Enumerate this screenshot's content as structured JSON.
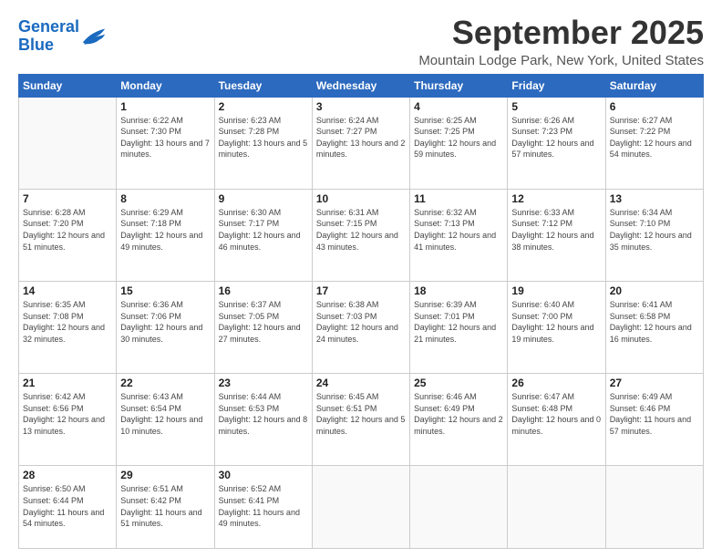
{
  "logo": {
    "line1": "General",
    "line2": "Blue"
  },
  "title": "September 2025",
  "location": "Mountain Lodge Park, New York, United States",
  "days_header": [
    "Sunday",
    "Monday",
    "Tuesday",
    "Wednesday",
    "Thursday",
    "Friday",
    "Saturday"
  ],
  "weeks": [
    [
      {
        "num": "",
        "sunrise": "",
        "sunset": "",
        "daylight": ""
      },
      {
        "num": "1",
        "sunrise": "Sunrise: 6:22 AM",
        "sunset": "Sunset: 7:30 PM",
        "daylight": "Daylight: 13 hours and 7 minutes."
      },
      {
        "num": "2",
        "sunrise": "Sunrise: 6:23 AM",
        "sunset": "Sunset: 7:28 PM",
        "daylight": "Daylight: 13 hours and 5 minutes."
      },
      {
        "num": "3",
        "sunrise": "Sunrise: 6:24 AM",
        "sunset": "Sunset: 7:27 PM",
        "daylight": "Daylight: 13 hours and 2 minutes."
      },
      {
        "num": "4",
        "sunrise": "Sunrise: 6:25 AM",
        "sunset": "Sunset: 7:25 PM",
        "daylight": "Daylight: 12 hours and 59 minutes."
      },
      {
        "num": "5",
        "sunrise": "Sunrise: 6:26 AM",
        "sunset": "Sunset: 7:23 PM",
        "daylight": "Daylight: 12 hours and 57 minutes."
      },
      {
        "num": "6",
        "sunrise": "Sunrise: 6:27 AM",
        "sunset": "Sunset: 7:22 PM",
        "daylight": "Daylight: 12 hours and 54 minutes."
      }
    ],
    [
      {
        "num": "7",
        "sunrise": "Sunrise: 6:28 AM",
        "sunset": "Sunset: 7:20 PM",
        "daylight": "Daylight: 12 hours and 51 minutes."
      },
      {
        "num": "8",
        "sunrise": "Sunrise: 6:29 AM",
        "sunset": "Sunset: 7:18 PM",
        "daylight": "Daylight: 12 hours and 49 minutes."
      },
      {
        "num": "9",
        "sunrise": "Sunrise: 6:30 AM",
        "sunset": "Sunset: 7:17 PM",
        "daylight": "Daylight: 12 hours and 46 minutes."
      },
      {
        "num": "10",
        "sunrise": "Sunrise: 6:31 AM",
        "sunset": "Sunset: 7:15 PM",
        "daylight": "Daylight: 12 hours and 43 minutes."
      },
      {
        "num": "11",
        "sunrise": "Sunrise: 6:32 AM",
        "sunset": "Sunset: 7:13 PM",
        "daylight": "Daylight: 12 hours and 41 minutes."
      },
      {
        "num": "12",
        "sunrise": "Sunrise: 6:33 AM",
        "sunset": "Sunset: 7:12 PM",
        "daylight": "Daylight: 12 hours and 38 minutes."
      },
      {
        "num": "13",
        "sunrise": "Sunrise: 6:34 AM",
        "sunset": "Sunset: 7:10 PM",
        "daylight": "Daylight: 12 hours and 35 minutes."
      }
    ],
    [
      {
        "num": "14",
        "sunrise": "Sunrise: 6:35 AM",
        "sunset": "Sunset: 7:08 PM",
        "daylight": "Daylight: 12 hours and 32 minutes."
      },
      {
        "num": "15",
        "sunrise": "Sunrise: 6:36 AM",
        "sunset": "Sunset: 7:06 PM",
        "daylight": "Daylight: 12 hours and 30 minutes."
      },
      {
        "num": "16",
        "sunrise": "Sunrise: 6:37 AM",
        "sunset": "Sunset: 7:05 PM",
        "daylight": "Daylight: 12 hours and 27 minutes."
      },
      {
        "num": "17",
        "sunrise": "Sunrise: 6:38 AM",
        "sunset": "Sunset: 7:03 PM",
        "daylight": "Daylight: 12 hours and 24 minutes."
      },
      {
        "num": "18",
        "sunrise": "Sunrise: 6:39 AM",
        "sunset": "Sunset: 7:01 PM",
        "daylight": "Daylight: 12 hours and 21 minutes."
      },
      {
        "num": "19",
        "sunrise": "Sunrise: 6:40 AM",
        "sunset": "Sunset: 7:00 PM",
        "daylight": "Daylight: 12 hours and 19 minutes."
      },
      {
        "num": "20",
        "sunrise": "Sunrise: 6:41 AM",
        "sunset": "Sunset: 6:58 PM",
        "daylight": "Daylight: 12 hours and 16 minutes."
      }
    ],
    [
      {
        "num": "21",
        "sunrise": "Sunrise: 6:42 AM",
        "sunset": "Sunset: 6:56 PM",
        "daylight": "Daylight: 12 hours and 13 minutes."
      },
      {
        "num": "22",
        "sunrise": "Sunrise: 6:43 AM",
        "sunset": "Sunset: 6:54 PM",
        "daylight": "Daylight: 12 hours and 10 minutes."
      },
      {
        "num": "23",
        "sunrise": "Sunrise: 6:44 AM",
        "sunset": "Sunset: 6:53 PM",
        "daylight": "Daylight: 12 hours and 8 minutes."
      },
      {
        "num": "24",
        "sunrise": "Sunrise: 6:45 AM",
        "sunset": "Sunset: 6:51 PM",
        "daylight": "Daylight: 12 hours and 5 minutes."
      },
      {
        "num": "25",
        "sunrise": "Sunrise: 6:46 AM",
        "sunset": "Sunset: 6:49 PM",
        "daylight": "Daylight: 12 hours and 2 minutes."
      },
      {
        "num": "26",
        "sunrise": "Sunrise: 6:47 AM",
        "sunset": "Sunset: 6:48 PM",
        "daylight": "Daylight: 12 hours and 0 minutes."
      },
      {
        "num": "27",
        "sunrise": "Sunrise: 6:49 AM",
        "sunset": "Sunset: 6:46 PM",
        "daylight": "Daylight: 11 hours and 57 minutes."
      }
    ],
    [
      {
        "num": "28",
        "sunrise": "Sunrise: 6:50 AM",
        "sunset": "Sunset: 6:44 PM",
        "daylight": "Daylight: 11 hours and 54 minutes."
      },
      {
        "num": "29",
        "sunrise": "Sunrise: 6:51 AM",
        "sunset": "Sunset: 6:42 PM",
        "daylight": "Daylight: 11 hours and 51 minutes."
      },
      {
        "num": "30",
        "sunrise": "Sunrise: 6:52 AM",
        "sunset": "Sunset: 6:41 PM",
        "daylight": "Daylight: 11 hours and 49 minutes."
      },
      {
        "num": "",
        "sunrise": "",
        "sunset": "",
        "daylight": ""
      },
      {
        "num": "",
        "sunrise": "",
        "sunset": "",
        "daylight": ""
      },
      {
        "num": "",
        "sunrise": "",
        "sunset": "",
        "daylight": ""
      },
      {
        "num": "",
        "sunrise": "",
        "sunset": "",
        "daylight": ""
      }
    ]
  ]
}
